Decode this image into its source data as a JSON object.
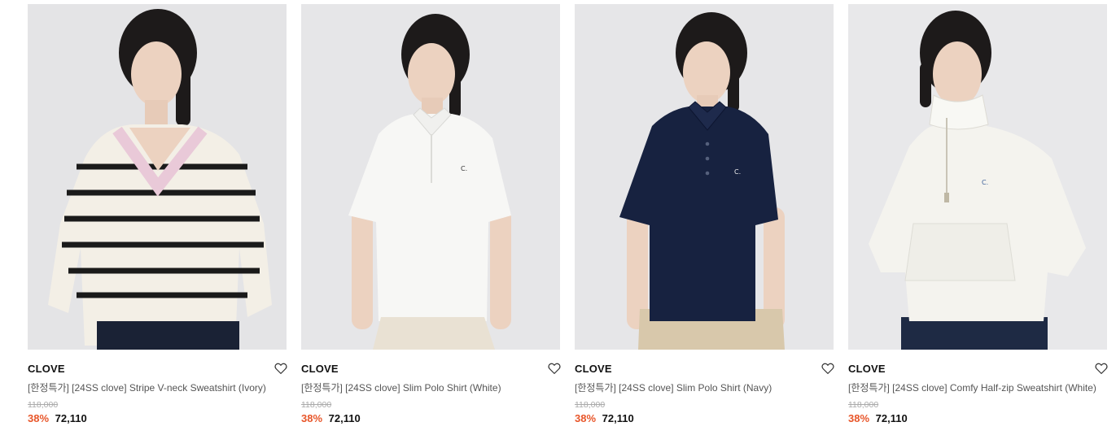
{
  "products": [
    {
      "brand": "CLOVE",
      "title": "[한정특가] [24SS clove] Stripe V-neck Sweatshirt (Ivory)",
      "original_price": "118,000",
      "discount": "38%",
      "sale_price": "72,110",
      "garment_color": "#f3efe6",
      "accent_color": "#e9c9d8"
    },
    {
      "brand": "CLOVE",
      "title": "[한정특가] [24SS clove] Slim Polo Shirt (White)",
      "original_price": "118,000",
      "discount": "38%",
      "sale_price": "72,110",
      "garment_color": "#f7f7f5",
      "accent_color": "#e9e1d3"
    },
    {
      "brand": "CLOVE",
      "title": "[한정특가] [24SS clove] Slim Polo Shirt (Navy)",
      "original_price": "118,000",
      "discount": "38%",
      "sale_price": "72,110",
      "garment_color": "#172240",
      "accent_color": "#d8c8ab"
    },
    {
      "brand": "CLOVE",
      "title": "[한정특가] [24SS clove] Comfy Half-zip Sweatshirt (White)",
      "original_price": "118,000",
      "discount": "38%",
      "sale_price": "72,110",
      "garment_color": "#f4f3ee",
      "accent_color": "#1e2a44"
    }
  ],
  "icons": {
    "wishlist": "heart-outline-icon"
  },
  "colors": {
    "discount": "#e8562a",
    "photo_background": "#e6e6e8"
  }
}
